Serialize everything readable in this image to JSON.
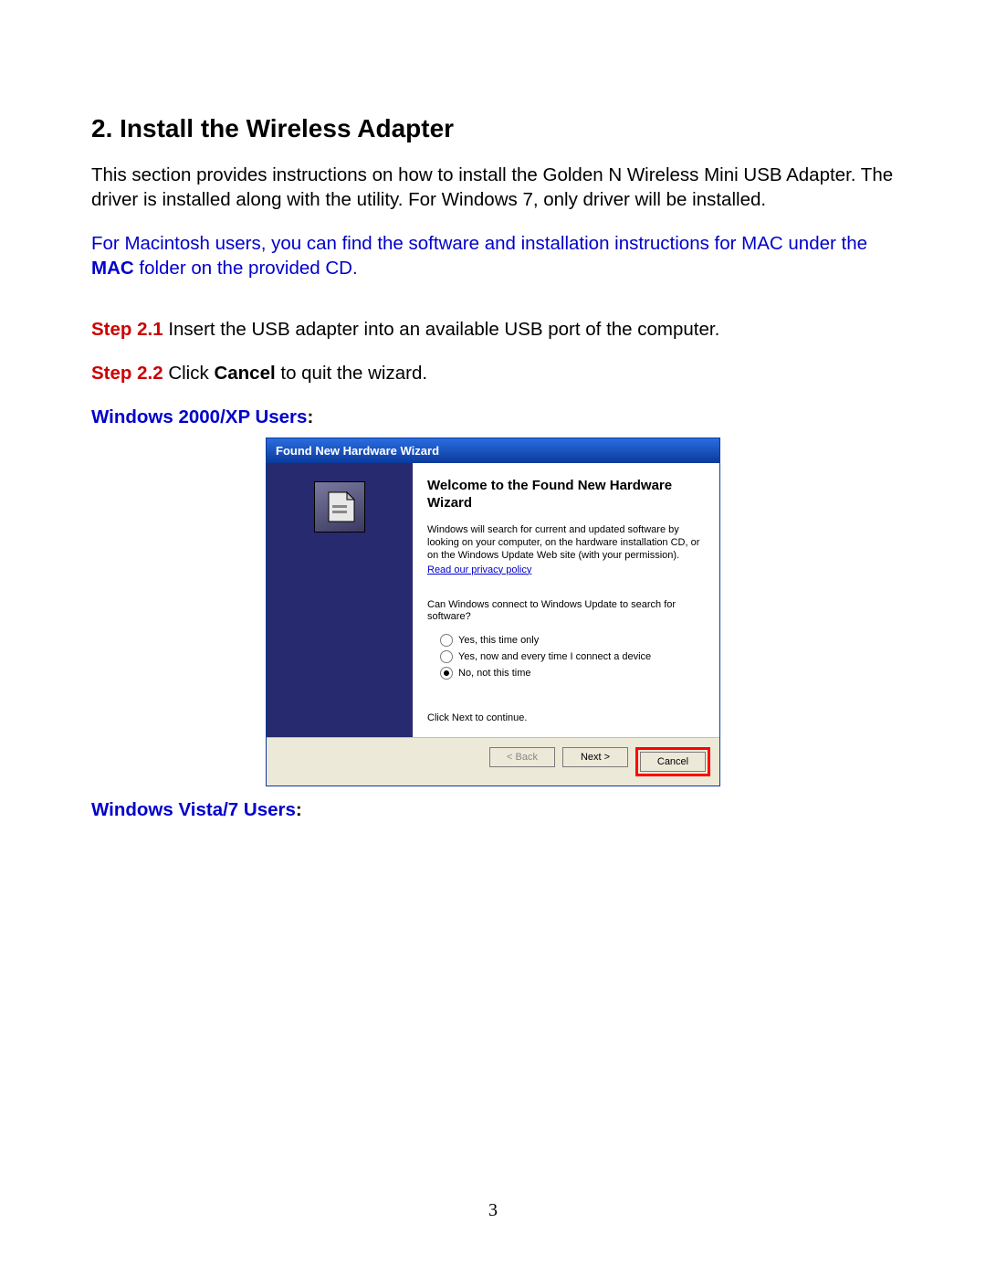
{
  "section": {
    "title": "2. Install the Wireless Adapter",
    "intro": "This section provides instructions on how to install the Golden N Wireless Mini USB Adapter. The driver is installed along with the utility. For Windows 7, only driver will be installed."
  },
  "mac_note": {
    "part1": "For Macintosh users, you can find the software and installation instructions for MAC under the ",
    "bold": "MAC",
    "part2": " folder on the provided CD."
  },
  "steps": {
    "s1_label": "Step 2.1",
    "s1_text": " Insert the USB adapter into an available USB port of the computer.",
    "s2_label": "Step 2.2",
    "s2_text_a": " Click ",
    "s2_bold": "Cancel",
    "s2_text_b": " to quit the wizard."
  },
  "subheadings": {
    "win2000xp": "Windows 2000/XP Users",
    "winvista7": "Windows Vista/7 Users",
    "colon": ":"
  },
  "dialog": {
    "title": "Found New Hardware Wizard",
    "welcome": "Welcome to the Found New Hardware Wizard",
    "desc": "Windows will search for current and updated software by looking on your computer, on the hardware installation CD, or on the Windows Update Web site (with your permission).",
    "privacy_link": "Read our privacy policy",
    "question": "Can Windows connect to Windows Update to search for software?",
    "opt1": "Yes, this time only",
    "opt2": "Yes, now and every time I connect a device",
    "opt3": "No, not this time",
    "continue": "Click Next to continue.",
    "btn_back": "< Back",
    "btn_next": "Next >",
    "btn_cancel": "Cancel"
  },
  "page_number": "3"
}
